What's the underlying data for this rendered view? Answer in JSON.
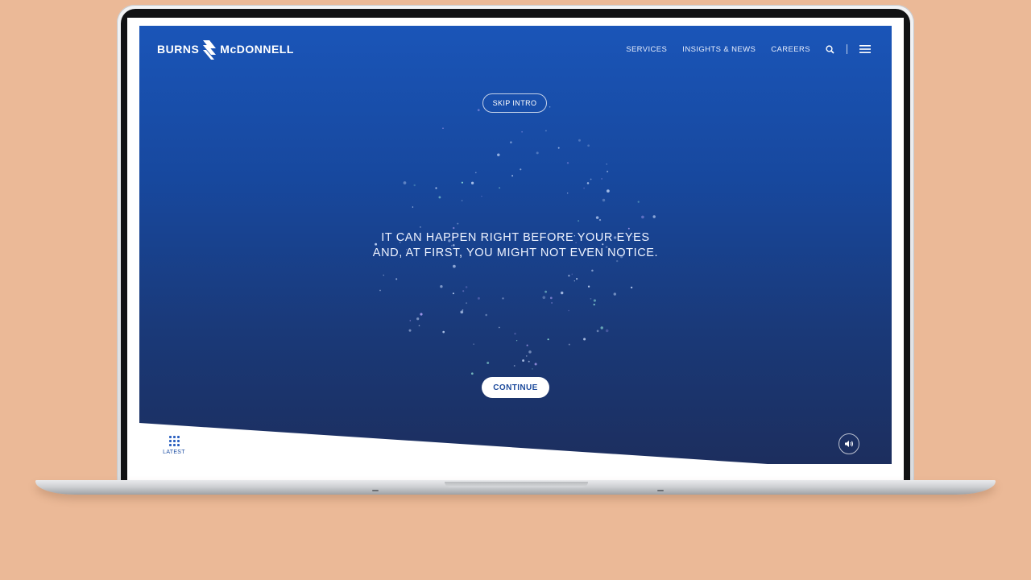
{
  "brand": {
    "logo_text_left": "BURNS",
    "logo_text_right": "McDONNELL"
  },
  "nav": {
    "items": [
      "SERVICES",
      "INSIGHTS & NEWS",
      "CAREERS"
    ],
    "search_icon": "search-icon",
    "menu_icon": "hamburger-menu-icon"
  },
  "intro": {
    "skip_label": "SKIP INTRO",
    "headline_line1": "IT CAN HAPPEN RIGHT BEFORE YOUR EYES",
    "headline_line2": "AND, AT FIRST, YOU MIGHT NOT EVEN NOTICE.",
    "continue_label": "CONTINUE"
  },
  "footer": {
    "latest_label": "LATEST",
    "latest_icon": "grid-dots-icon",
    "sound_icon": "speaker-icon"
  },
  "colors": {
    "page_background": "#ebb997",
    "screen_gradient_top": "#1a55b8",
    "screen_gradient_bottom": "#1c2e5e",
    "accent_blue": "#1c4a9c",
    "white": "#ffffff"
  }
}
